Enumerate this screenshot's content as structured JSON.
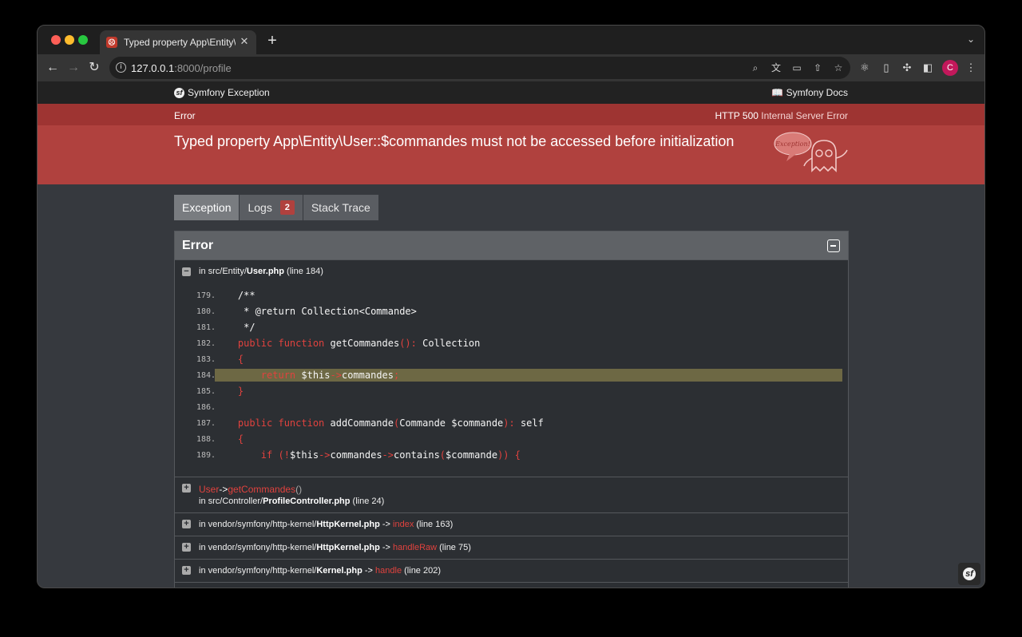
{
  "browser": {
    "tab_title": "Typed property App\\Entity\\User::$commandes must not be accessed before initialization",
    "favicon_glyph": "☹",
    "url_host": "127.0.0.1",
    "url_rest": ":8000/profile",
    "new_tab": "+",
    "close": "✕",
    "tab_menu": "⌄",
    "avatar_letter": "C"
  },
  "sf_bar": {
    "brand": "Symfony Exception",
    "docs": "Symfony Docs",
    "logo_glyph": "sf",
    "docs_glyph": "📖"
  },
  "exception": {
    "label": "Error",
    "http_code": "HTTP 500",
    "http_text": "Internal Server Error",
    "message": "Typed property App\\Entity\\User::$commandes must not be accessed before initialization",
    "bubble": "Exception!"
  },
  "tabs": [
    {
      "label": "Exception"
    },
    {
      "label": "Logs",
      "badge": "2"
    },
    {
      "label": "Stack Trace"
    }
  ],
  "panel": {
    "title": "Error",
    "first_frame": {
      "prefix": "in src/Entity/",
      "file": "User.php",
      "line": "(line 184)"
    },
    "code_lines": [
      {
        "n": "179.",
        "html": "    /**"
      },
      {
        "n": "180.",
        "html": "     * @return Collection<Commande>"
      },
      {
        "n": "181.",
        "html": "     */"
      },
      {
        "n": "182.",
        "parts": [
          [
            "    ",
            ""
          ],
          [
            "public function",
            "kw"
          ],
          [
            " getCommandes",
            ""
          ],
          [
            "()",
            "op"
          ],
          [
            ":",
            "op"
          ],
          [
            " Collection",
            ""
          ]
        ]
      },
      {
        "n": "183.",
        "parts": [
          [
            "    ",
            ""
          ],
          [
            "{",
            "op"
          ]
        ]
      },
      {
        "n": "184.",
        "hl": true,
        "parts": [
          [
            "        ",
            ""
          ],
          [
            "return",
            "kw"
          ],
          [
            " $this",
            ""
          ],
          [
            "->",
            "op"
          ],
          [
            "commandes",
            ""
          ],
          [
            ";",
            "op"
          ]
        ]
      },
      {
        "n": "185.",
        "parts": [
          [
            "    ",
            ""
          ],
          [
            "}",
            "op"
          ]
        ]
      },
      {
        "n": "186.",
        "html": ""
      },
      {
        "n": "187.",
        "parts": [
          [
            "    ",
            ""
          ],
          [
            "public function",
            "kw"
          ],
          [
            " addCommande",
            ""
          ],
          [
            "(",
            "op"
          ],
          [
            "Commande $commande",
            ""
          ],
          [
            "):",
            "op"
          ],
          [
            " self",
            ""
          ]
        ]
      },
      {
        "n": "188.",
        "parts": [
          [
            "    ",
            ""
          ],
          [
            "{",
            "op"
          ]
        ]
      },
      {
        "n": "189.",
        "parts": [
          [
            "        ",
            ""
          ],
          [
            "if",
            "kw"
          ],
          [
            " ",
            ""
          ],
          [
            "(!",
            "op"
          ],
          [
            "$this",
            ""
          ],
          [
            "->",
            "op"
          ],
          [
            "commandes",
            ""
          ],
          [
            "->",
            "op"
          ],
          [
            "contains",
            ""
          ],
          [
            "(",
            "op"
          ],
          [
            "$commande",
            ""
          ],
          [
            "))",
            "op"
          ],
          [
            " {",
            "op"
          ]
        ]
      }
    ],
    "frames": [
      {
        "cls": "User",
        "arrow": "->",
        "fn": "getCommandes",
        "paren": "()",
        "prefix": "in src/Controller/",
        "file": "ProfileController.php",
        "line": "(line 24)"
      },
      {
        "prefix": "in vendor/symfony/http-kernel/",
        "file": "HttpKernel.php",
        "arrow": "->",
        "fn": "index",
        "line": "(line 163)"
      },
      {
        "prefix": "in vendor/symfony/http-kernel/",
        "file": "HttpKernel.php",
        "arrow": "->",
        "fn": "handleRaw",
        "line": "(line 75)"
      },
      {
        "prefix": "in vendor/symfony/http-kernel/",
        "file": "Kernel.php",
        "arrow": "->",
        "fn": "handle",
        "line": "(line 202)"
      }
    ]
  }
}
